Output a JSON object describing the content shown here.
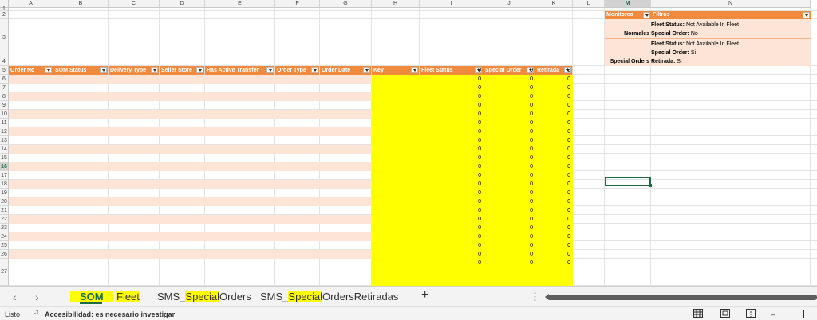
{
  "column_letters": [
    "A",
    "B",
    "C",
    "D",
    "E",
    "F",
    "G",
    "H",
    "I",
    "J",
    "K",
    "L",
    "M",
    "N"
  ],
  "row_numbers": [
    "1",
    "2",
    "3",
    "4",
    "5",
    "6",
    "7",
    "8",
    "9",
    "10",
    "11",
    "12",
    "13",
    "14",
    "15",
    "16",
    "17",
    "18",
    "19",
    "20",
    "21",
    "22",
    "23",
    "24",
    "25",
    "26",
    "27"
  ],
  "selected_column": "M",
  "selected_row": "16",
  "table": {
    "headers": [
      "Order No",
      "SOM Status",
      "Delivery Type",
      "Seller Store",
      "Has Active Transfer",
      "Order Type",
      "Order Date",
      "Key",
      "Fleet Status",
      "Special Order",
      "Retirada"
    ],
    "row_value": "0"
  },
  "pivot": {
    "headers": [
      "Monitoreo",
      "Filtros"
    ],
    "rows": [
      {
        "label": "Normales",
        "lines": [
          {
            "k": "Fleet Status:",
            "v": "Not Available In Fleet"
          },
          {
            "k": "Special Order:",
            "v": "No"
          }
        ]
      },
      {
        "label": "Special Orders",
        "lines": [
          {
            "k": "Fleet Status:",
            "v": "Not Available In Fleet"
          },
          {
            "k": "Special Order:",
            "v": "Si"
          },
          {
            "k": "Retirada:",
            "v": "Si"
          }
        ]
      }
    ]
  },
  "tabs": {
    "som": "SOM",
    "fleet": "Fleet",
    "special_prefix": "SMS_",
    "special_mid": "Special",
    "special_suffix": "Orders",
    "retiradas_prefix": "SMS_",
    "retiradas_mid": "Special",
    "retiradas_suffix": "OrdersRetiradas",
    "add": "+",
    "more": "⋮"
  },
  "status_bar": {
    "ready": "Listo",
    "accessibility": "Accesibilidad: es necesario investigar"
  },
  "colors": {
    "table_header": "#f08a3e",
    "band": "#fce4d6",
    "highlight": "#ffff00",
    "excel_green": "#1e6b41"
  }
}
